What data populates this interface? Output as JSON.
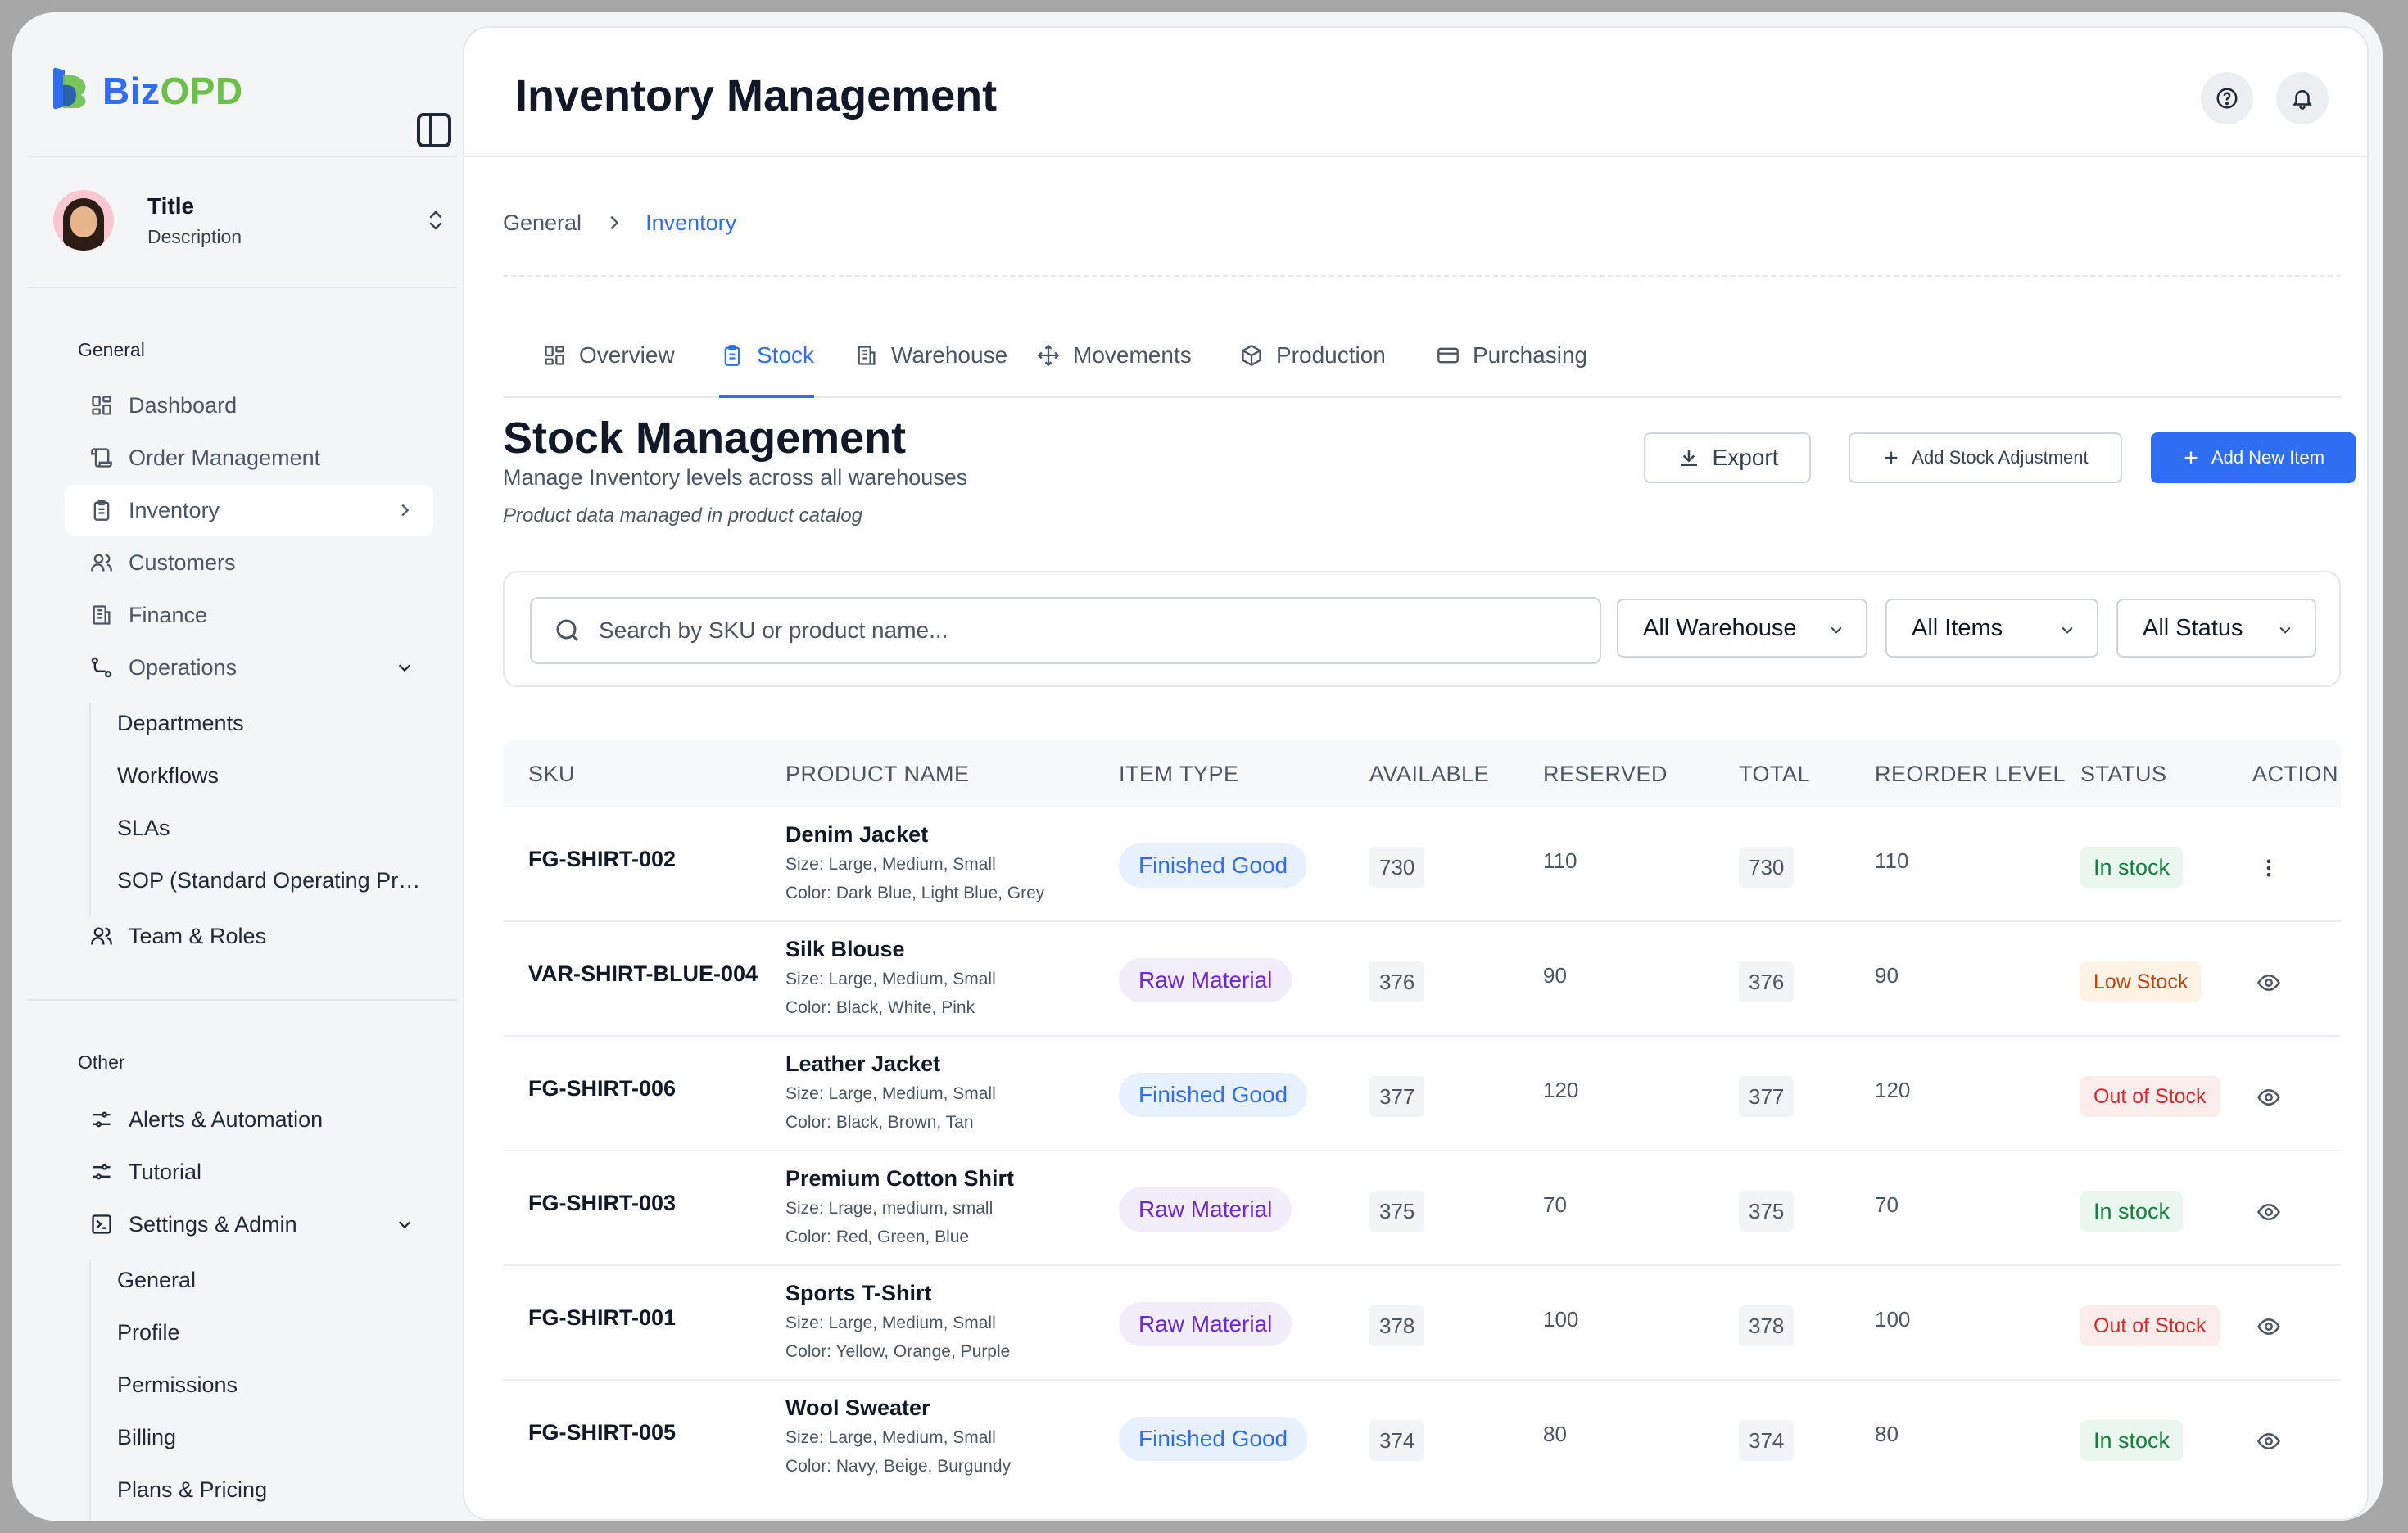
{
  "brand": {
    "name_part1": "Biz",
    "name_part2": "OPD",
    "color_primary": "#2f6df2",
    "color_secondary": "#6cc04a"
  },
  "user": {
    "title": "Title",
    "description": "Description"
  },
  "sidebar": {
    "general_label": "General",
    "items": [
      {
        "label": "Dashboard",
        "icon": "grid-icon"
      },
      {
        "label": "Order Management",
        "icon": "scroll-icon"
      },
      {
        "label": "Inventory",
        "icon": "clipboard-icon",
        "active": true
      },
      {
        "label": "Customers",
        "icon": "users-icon"
      },
      {
        "label": "Finance",
        "icon": "building-icon"
      },
      {
        "label": "Operations",
        "icon": "route-icon",
        "expanded": true
      }
    ],
    "operations_sub": [
      "Departments",
      "Workflows",
      "SLAs",
      "SOP (Standard Operating Procedures)"
    ],
    "team_label": "Team & Roles",
    "other_label": "Other",
    "other_items": [
      {
        "label": "Alerts & Automation",
        "icon": "sliders-icon"
      },
      {
        "label": "Tutorial",
        "icon": "sliders-icon"
      },
      {
        "label": "Settings & Admin",
        "icon": "terminal-icon",
        "expanded": true
      }
    ],
    "settings_sub": [
      "General",
      "Profile",
      "Permissions",
      "Billing",
      "Plans & Pricing"
    ]
  },
  "header": {
    "title": "Inventory Management"
  },
  "breadcrumb": {
    "root": "General",
    "current": "Inventory"
  },
  "tabs": [
    {
      "label": "Overview",
      "icon": "grid-icon"
    },
    {
      "label": "Stock",
      "icon": "clipboard-icon",
      "active": true
    },
    {
      "label": "Warehouse",
      "icon": "building-icon"
    },
    {
      "label": "Movements",
      "icon": "move-icon"
    },
    {
      "label": "Production",
      "icon": "box-icon"
    },
    {
      "label": "Purchasing",
      "icon": "card-icon"
    }
  ],
  "section": {
    "title": "Stock Management",
    "subtitle": "Manage Inventory levels across all warehouses",
    "note": "Product data managed in product catalog"
  },
  "actions": {
    "export": "Export",
    "adjustment": "Add Stock Adjustment",
    "add_new": "Add New Item"
  },
  "filters": {
    "search_placeholder": "Search by SKU or product name...",
    "warehouse": "All Warehouse",
    "items": "All Items",
    "status": "All Status"
  },
  "table": {
    "columns": [
      "SKU",
      "PRODUCT NAME",
      "ITEM TYPE",
      "AVAILABLE",
      "RESERVED",
      "TOTAL",
      "REORDER LEVEL",
      "STATUS",
      "ACTION"
    ],
    "rows": [
      {
        "sku": "FG-SHIRT-002",
        "name": "Denim Jacket",
        "size": "Size: Large, Medium, Small",
        "color": "Color: Dark Blue, Light Blue, Grey",
        "type": "Finished Good",
        "available": "730",
        "reserved": "110",
        "total": "730",
        "reorder": "110",
        "status": "In stock",
        "action": "more-vertical-icon"
      },
      {
        "sku": "VAR-SHIRT-BLUE-004",
        "name": "Silk Blouse",
        "size": "Size: Large, Medium, Small",
        "color": "Color: Black, White, Pink",
        "type": "Raw Material",
        "available": "376",
        "reserved": "90",
        "total": "376",
        "reorder": "90",
        "status": "Low Stock",
        "action": "eye-icon"
      },
      {
        "sku": "FG-SHIRT-006",
        "name": "Leather Jacket",
        "size": "Size: Large, Medium, Small",
        "color": "Color: Black, Brown, Tan",
        "type": "Finished Good",
        "available": "377",
        "reserved": "120",
        "total": "377",
        "reorder": "120",
        "status": "Out of Stock",
        "action": "eye-icon"
      },
      {
        "sku": "FG-SHIRT-003",
        "name": "Premium Cotton Shirt",
        "size": "Size: Lrage, medium, small",
        "color": "Color: Red, Green, Blue",
        "type": "Raw Material",
        "available": "375",
        "reserved": "70",
        "total": "375",
        "reorder": "70",
        "status": "In stock",
        "action": "eye-icon"
      },
      {
        "sku": "FG-SHIRT-001",
        "name": "Sports T-Shirt",
        "size": "Size: Large, Medium, Small",
        "color": "Color: Yellow, Orange, Purple",
        "type": "Raw Material",
        "available": "378",
        "reserved": "100",
        "total": "378",
        "reorder": "100",
        "status": "Out of Stock",
        "action": "eye-icon"
      },
      {
        "sku": "FG-SHIRT-005",
        "name": "Wool Sweater",
        "size": "Size: Large, Medium, Small",
        "color": "Color: Navy, Beige, Burgundy",
        "type": "Finished Good",
        "available": "374",
        "reserved": "80",
        "total": "374",
        "reorder": "80",
        "status": "In stock",
        "action": "eye-icon"
      }
    ]
  }
}
